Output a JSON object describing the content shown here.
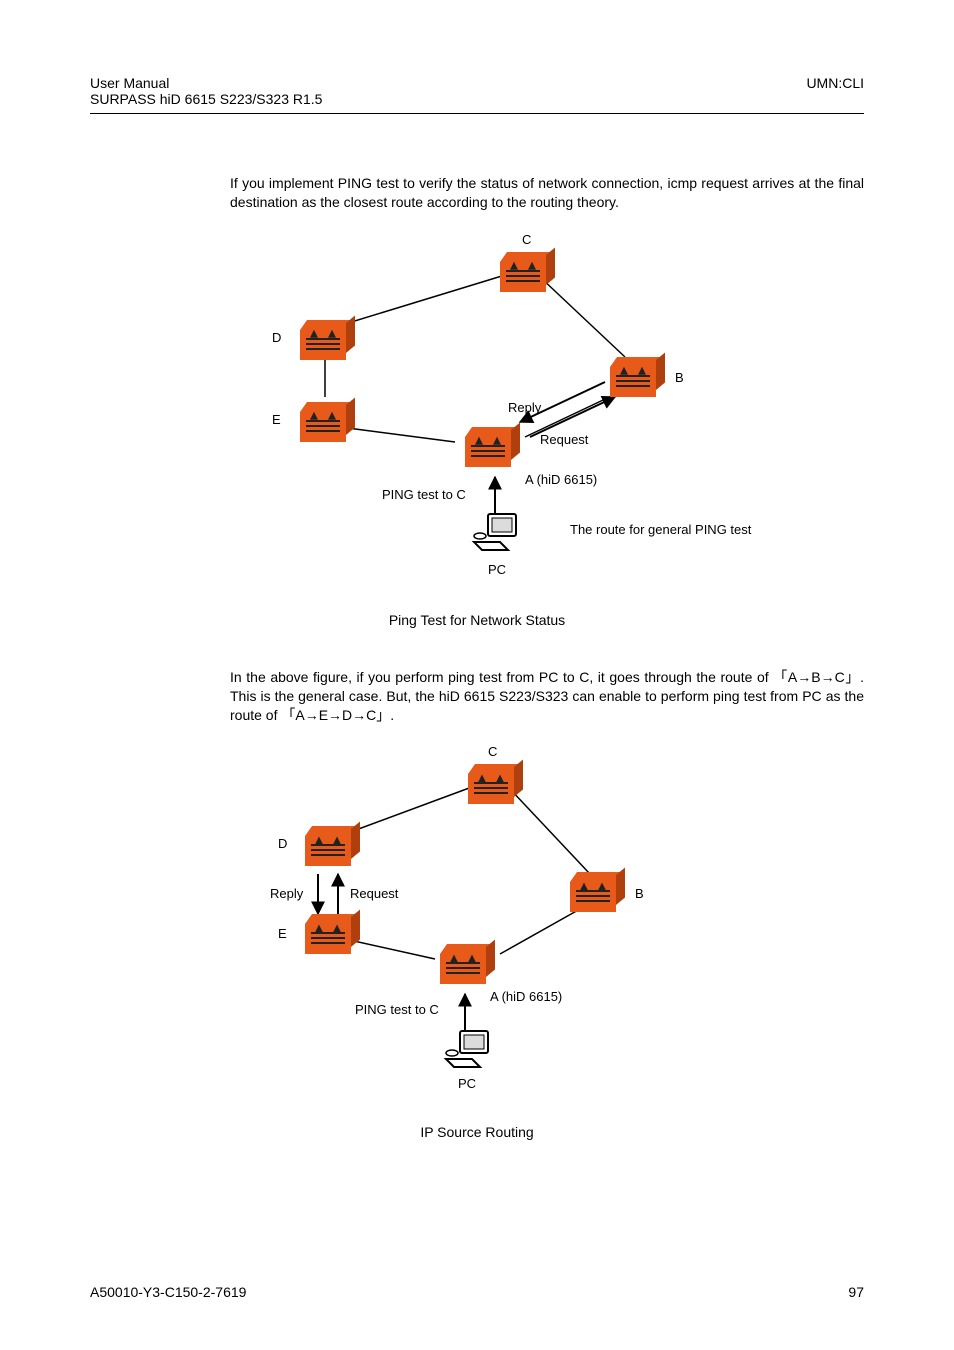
{
  "header": {
    "left1": "User Manual",
    "left2": "SURPASS hiD 6615 S223/S323 R1.5",
    "right": "UMN:CLI"
  },
  "para1": "If you implement PING test to verify the status of network connection, icmp request arrives at the final destination as the closest route according to the routing theory.",
  "fig1": {
    "C": "C",
    "D": "D",
    "E": "E",
    "B": "B",
    "reply": "Reply",
    "request": "Request",
    "A": "A (hiD 6615)",
    "ping": "PING test to C",
    "route": "The route for general PING test",
    "pc": "PC"
  },
  "caption1": "Ping Test for Network Status",
  "para2_1": "In the above figure, if you perform ping test from PC to C, it goes through the route of 「A→B→C」. This is the general case. But, the hiD 6615 S223/S323 can enable to perform ping test from PC as the route of 「A→E→D→C」.",
  "fig2": {
    "C": "C",
    "D": "D",
    "E": "E",
    "B": "B",
    "reply": "Reply",
    "request": "Request",
    "A": "A (hiD 6615)",
    "ping": "PING test to C",
    "pc": "PC"
  },
  "caption2": "IP Source Routing",
  "footer": {
    "left": "A50010-Y3-C150-2-7619",
    "right": "97"
  }
}
